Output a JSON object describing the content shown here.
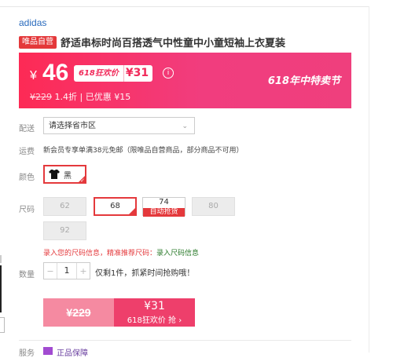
{
  "brand": "adidas",
  "title": {
    "tag": "唯品自营",
    "text": "舒适串标时尚百搭透气中性童中小童短袖上衣夏装"
  },
  "promo": {
    "currency": "¥",
    "price": "46",
    "badge": "618狂欢价",
    "badge_price": "¥31",
    "info_icon": "info-icon",
    "festival": "618年中特卖节",
    "original_price": "¥229",
    "discount": "1.4折",
    "saving": "已优惠 ¥15",
    "colors": {
      "start": "#fd2a55",
      "end": "#ef3f7d"
    }
  },
  "delivery": {
    "label": "配送",
    "placeholder": "请选择省市区"
  },
  "shipping": {
    "label": "运费",
    "text": "新会员专享单满38元免邮（限唯品自营商品，部分商品不可用）"
  },
  "color": {
    "label": "颜色",
    "option": "黑"
  },
  "size": {
    "label": "尺码",
    "options": [
      {
        "label": "62",
        "state": "disabled"
      },
      {
        "label": "68",
        "state": "selected"
      },
      {
        "label": "74",
        "badge": "自动抢货",
        "state": "available"
      },
      {
        "label": "80",
        "state": "disabled"
      },
      {
        "label": "92",
        "state": "disabled"
      }
    ],
    "tip_part1": "录入您的尺码信息，精准推荐尺码：",
    "tip_link": "录入尺码信息"
  },
  "quantity": {
    "label": "数量",
    "minus": "−",
    "value": "1",
    "plus": "+",
    "stock_text": "仅剩1件，抓紧时间抢购哦！"
  },
  "buy": {
    "left_price": "¥229",
    "right_price": "¥31",
    "right_label": "618狂欢价 抢 ›"
  },
  "service": {
    "label": "服务",
    "text": "正品保障"
  },
  "accent": "#e4393c"
}
